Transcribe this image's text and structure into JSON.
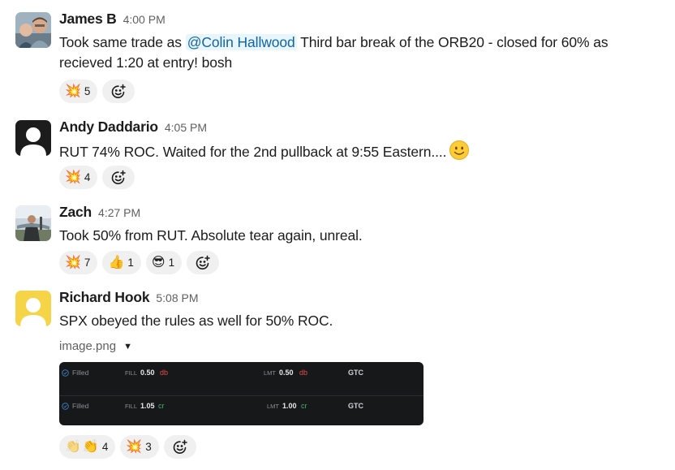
{
  "messages": [
    {
      "author": "James B",
      "time": "4:00 PM",
      "text_before": "Took same trade as ",
      "mention": "@Colin Hallwood",
      "text_after": " Third bar break of the ORB20 - closed for 60% as recieved 1:20 at entry! bosh",
      "reactions": [
        {
          "emoji": "💥",
          "count": "5"
        }
      ]
    },
    {
      "author": "Andy Daddario",
      "time": "4:05 PM",
      "text": "RUT 74% ROC. Waited for the 2nd pullback at 9:55 Eastern....",
      "reactions": [
        {
          "emoji": "💥",
          "count": "4"
        }
      ]
    },
    {
      "author": "Zach",
      "time": "4:27 PM",
      "text": "Took 50% from RUT. Absolute tear again, unreal.",
      "reactions": [
        {
          "emoji": "💥",
          "count": "7"
        },
        {
          "emoji": "👍",
          "count": "1"
        },
        {
          "emoji": "😎",
          "count": "1"
        }
      ]
    },
    {
      "author": "Richard Hook",
      "time": "5:08 PM",
      "text": "SPX obeyed the rules as well for 50% ROC.",
      "file_name": "image.png",
      "image": {
        "rows": [
          {
            "status": "Filled",
            "fill_label": "FILL",
            "fill_value": "0.50",
            "fill_side": "db",
            "lmt_label": "LMT",
            "lmt_value": "0.50",
            "lmt_side": "db",
            "tif": "GTC"
          },
          {
            "status": "Filled",
            "fill_label": "FILL",
            "fill_value": "1.05",
            "fill_side": "cr",
            "lmt_label": "LMT",
            "lmt_value": "1.00",
            "lmt_side": "cr",
            "tif": "GTC"
          }
        ]
      },
      "reactions": [
        {
          "emoji": "👏",
          "emoji_extra": "👏",
          "count": "4"
        },
        {
          "emoji": "💥",
          "count": "3"
        }
      ]
    }
  ],
  "icons": {
    "add_reaction": "add-reaction-icon",
    "inline_emoji": "slightly-smiling-face",
    "file_caret": "caret-down-icon"
  },
  "colors": {
    "mention_text": "#1264a3",
    "mention_bg": "#e8f5fa",
    "reaction_bg": "#f0f0f0",
    "timestamp": "#616061",
    "image_bg": "#17181a",
    "debit": "#e34b4b",
    "credit": "#3fb26b"
  }
}
